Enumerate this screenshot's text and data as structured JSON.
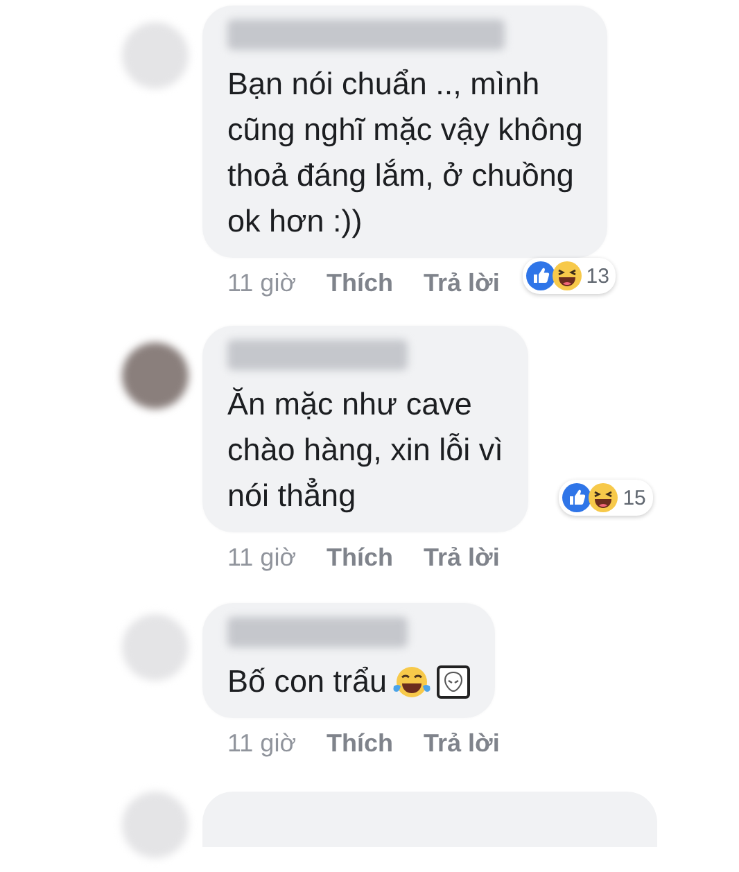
{
  "comments": [
    {
      "kind": "text",
      "lines": [
        "Bạn nói chuẩn .., mình",
        "cũng nghĩ mặc vậy không",
        "thoả đáng lắm, ở chuồng",
        "ok hơn :))"
      ],
      "time": "11 giờ",
      "like": "Thích",
      "reply": "Trả lời",
      "reaction_count": "13"
    },
    {
      "kind": "text",
      "lines": [
        "Ăn mặc như cave",
        "chào hàng, xin lỗi vì",
        "nói thẳng"
      ],
      "time": "11 giờ",
      "like": "Thích",
      "reply": "Trả lời",
      "reaction_count": "15"
    },
    {
      "kind": "emoji",
      "lines": [
        "Bố con trẩu"
      ],
      "time": "11 giờ",
      "like": "Thích",
      "reply": "Trả lời"
    },
    {
      "kind": "cut"
    }
  ]
}
